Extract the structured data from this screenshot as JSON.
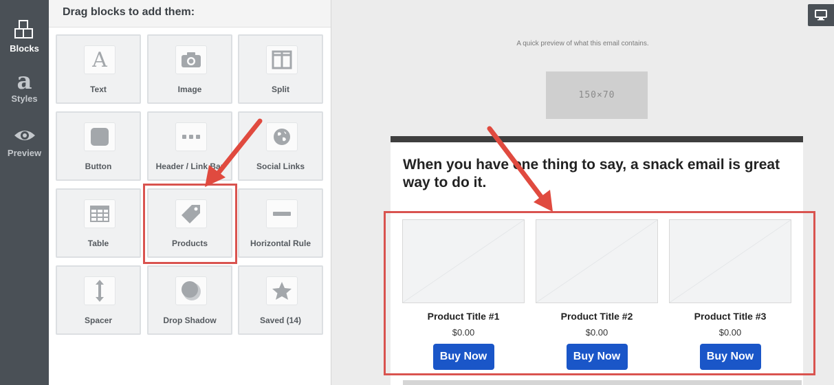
{
  "rail": {
    "items": [
      {
        "label": "Blocks",
        "icon": "blocks-icon",
        "active": true
      },
      {
        "label": "Styles",
        "icon": "styles-icon",
        "active": false
      },
      {
        "label": "Preview",
        "icon": "eye-icon",
        "active": false
      }
    ]
  },
  "panel": {
    "heading": "Drag blocks to add them:",
    "blocks": [
      {
        "label": "Text",
        "icon": "text-icon"
      },
      {
        "label": "Image",
        "icon": "camera-icon"
      },
      {
        "label": "Split",
        "icon": "split-icon"
      },
      {
        "label": "Button",
        "icon": "button-icon"
      },
      {
        "label": "Header / Link Bar",
        "icon": "dots-icon"
      },
      {
        "label": "Social Links",
        "icon": "globe-icon"
      },
      {
        "label": "Table",
        "icon": "table-icon"
      },
      {
        "label": "Products",
        "icon": "tag-icon"
      },
      {
        "label": "Horizontal Rule",
        "icon": "rule-icon"
      },
      {
        "label": "Spacer",
        "icon": "spacer-icon"
      },
      {
        "label": "Drop Shadow",
        "icon": "shadow-icon"
      },
      {
        "label": "Saved (14)",
        "icon": "star-icon"
      }
    ]
  },
  "canvas": {
    "device_icon": "desktop-icon",
    "preheader": "A quick preview of what this email contains.",
    "logo_placeholder": "150×70",
    "headline": "When you have one thing to say, a snack email is great way to do it.",
    "products": [
      {
        "title": "Product Title #1",
        "price": "$0.00",
        "button": "Buy Now"
      },
      {
        "title": "Product Title #2",
        "price": "$0.00",
        "button": "Buy Now"
      },
      {
        "title": "Product Title #3",
        "price": "$0.00",
        "button": "Buy Now"
      }
    ]
  },
  "colors": {
    "rail_bg": "#4a5056",
    "button_blue": "#1a56c8",
    "callout_red": "#d9534f"
  }
}
